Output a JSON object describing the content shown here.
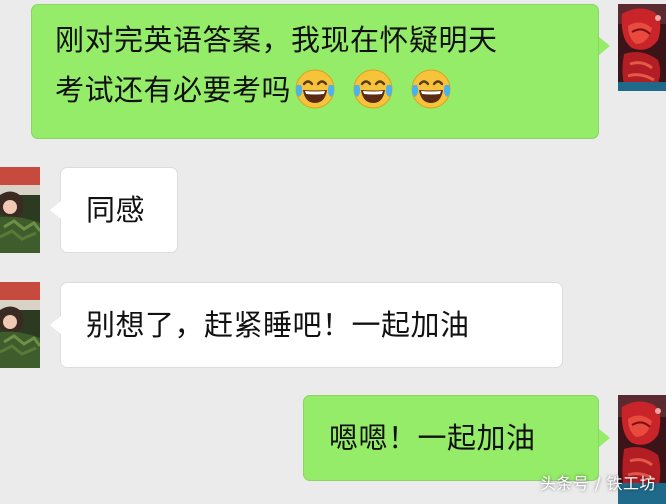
{
  "messages": [
    {
      "side": "right",
      "text_line1": "刚对完英语答案，我现在怀疑明天",
      "text_line2": "考试还有必要考吗",
      "emoji": [
        "laughing-tears-emoji",
        "laughing-tears-emoji",
        "laughing-tears-emoji"
      ]
    },
    {
      "side": "left",
      "text": "同感"
    },
    {
      "side": "left",
      "text": "别想了，赶紧睡吧！一起加油"
    },
    {
      "side": "right",
      "text": "嗯嗯！一起加油"
    }
  ],
  "watermark": "头条号 / 铁工坊",
  "colors": {
    "background": "#ebebeb",
    "sent_bubble": "#95ec69",
    "received_bubble": "#ffffff"
  }
}
